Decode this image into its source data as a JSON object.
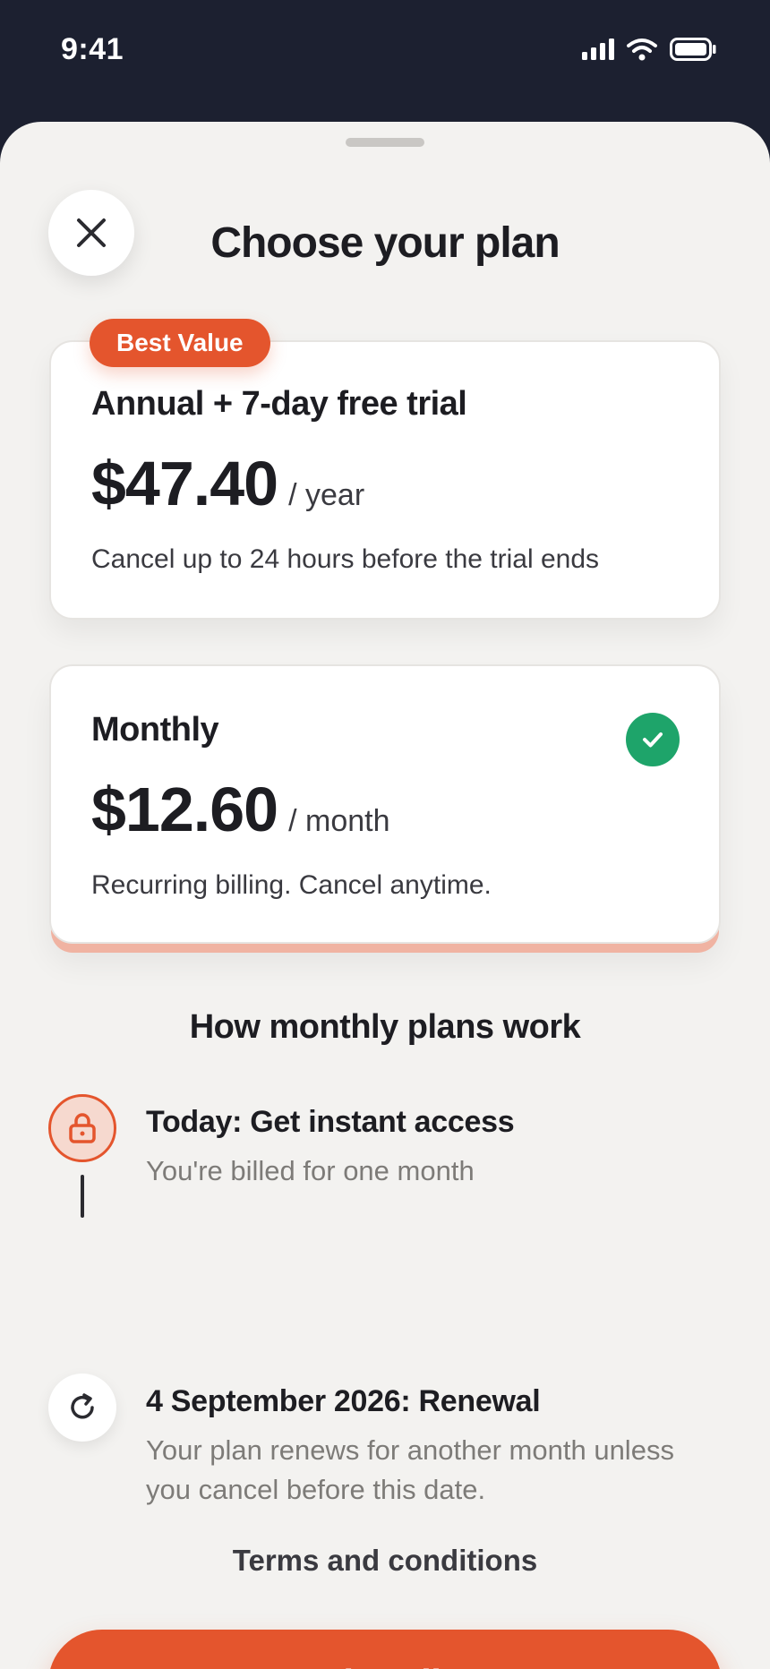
{
  "status_bar": {
    "time": "9:41",
    "icons": [
      "signal-icon",
      "wifi-icon",
      "battery-icon"
    ]
  },
  "sheet": {
    "title": "Choose your plan",
    "close_icon": "close-icon"
  },
  "plans": {
    "annual": {
      "badge": "Best Value",
      "name": "Annual + 7-day free trial",
      "price": "$47.40",
      "period": "/ year",
      "description": "Cancel up to 24 hours before the trial ends",
      "selected": false
    },
    "monthly": {
      "name": "Monthly",
      "price": "$12.60",
      "period": "/ month",
      "description": "Recurring billing. Cancel anytime.",
      "selected": true
    }
  },
  "how_it_works": {
    "title": "How monthly plans work",
    "steps": [
      {
        "icon": "lock-icon",
        "title": "Today: Get instant access",
        "description": "You're billed for one month"
      },
      {
        "icon": "refresh-icon",
        "title": "4 September 2026: Renewal",
        "description": "Your plan renews for another month unless you cancel before this date."
      }
    ]
  },
  "footer": {
    "terms_label": "Terms and conditions",
    "subscribe_label": "Subscribe"
  },
  "colors": {
    "accent": "#e4552d",
    "success": "#1ea46a",
    "background": "#f3f2f0",
    "status_bar": "#1c2030"
  }
}
